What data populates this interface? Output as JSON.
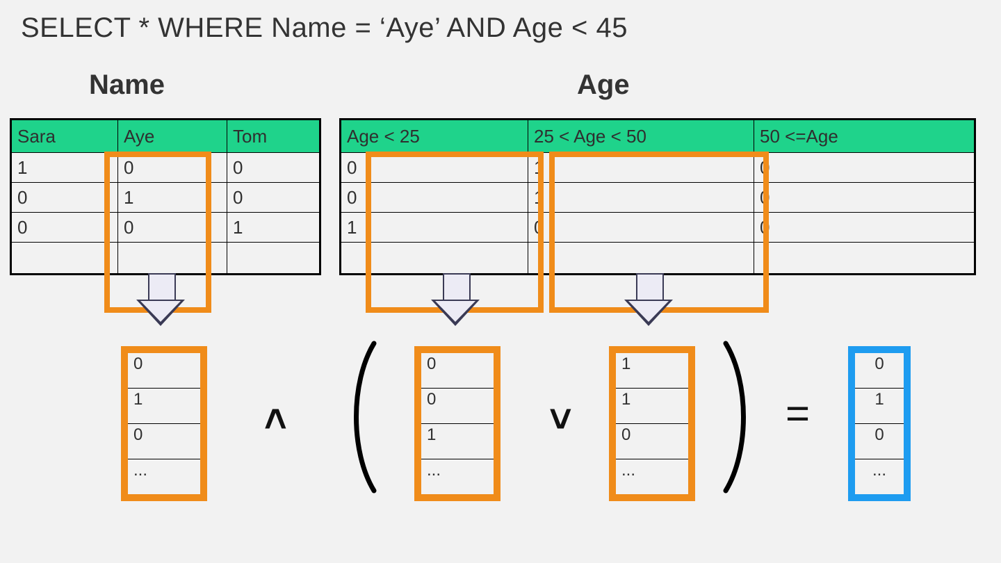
{
  "sql": "SELECT * WHERE Name = ‘Aye’ AND Age < 45",
  "name_table": {
    "title": "Name",
    "headers": [
      "Sara",
      "Aye",
      "Tom"
    ],
    "rows": [
      [
        "1",
        "0",
        "0"
      ],
      [
        "0",
        "1",
        "0"
      ],
      [
        "0",
        "0",
        "1"
      ]
    ]
  },
  "age_table": {
    "title": "Age",
    "headers": [
      "Age < 25",
      "25 < Age < 50",
      "50 <=Age"
    ],
    "rows": [
      [
        "0",
        "1",
        "0"
      ],
      [
        "0",
        "1",
        "0"
      ],
      [
        "1",
        "0",
        "0"
      ]
    ]
  },
  "vectors": {
    "aye": [
      "0",
      "1",
      "0",
      "..."
    ],
    "age_lt25": [
      "0",
      "0",
      "1",
      "..."
    ],
    "age_25_50": [
      "1",
      "1",
      "0",
      "..."
    ],
    "result": [
      "0",
      "1",
      "0",
      "..."
    ]
  },
  "ops": {
    "and": "˄",
    "or": "˅",
    "eq": "=",
    "lparen": "(",
    "rparen": ")"
  }
}
